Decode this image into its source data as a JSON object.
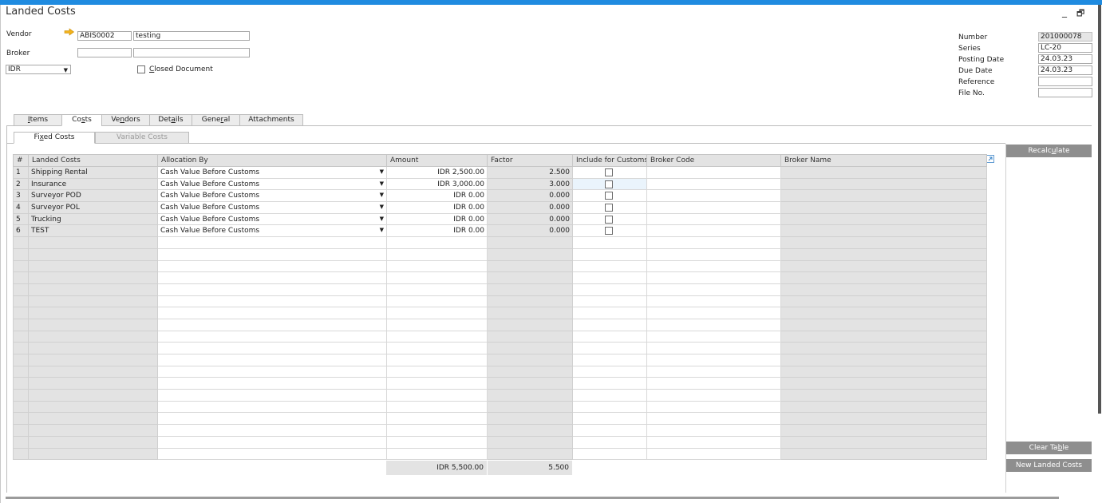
{
  "window": {
    "title": "Landed Costs",
    "minimize": "_",
    "restore": "🗗"
  },
  "header": {
    "vendor_label": "Vendor",
    "vendor_code": "ABIS0002",
    "vendor_name": "testing",
    "broker_label": "Broker",
    "broker_code": "",
    "broker_name": "",
    "currency": "IDR",
    "closed_label_pre": "",
    "closed_label_u": "C",
    "closed_label_post": "losed Document"
  },
  "doc": {
    "number_label": "Number",
    "number": "201000078",
    "series_label": "Series",
    "series": "LC-20",
    "posting_label": "Posting Date",
    "posting": "24.03.23",
    "due_label": "Due Date",
    "due": "24.03.23",
    "reference_label": "Reference",
    "reference": "",
    "file_label": "File No.",
    "file": ""
  },
  "tabs": [
    {
      "pre": "",
      "u": "I",
      "post": "tems"
    },
    {
      "pre": "Co",
      "u": "s",
      "post": "ts"
    },
    {
      "pre": "Ve",
      "u": "n",
      "post": "dors"
    },
    {
      "pre": "Det",
      "u": "a",
      "post": "ils"
    },
    {
      "pre": "Gene",
      "u": "r",
      "post": "al"
    },
    {
      "pre": "",
      "u": "",
      "post": "Attachments"
    }
  ],
  "subtabs": [
    {
      "pre": "Fi",
      "u": "x",
      "post": "ed Costs"
    },
    {
      "pre": "",
      "u": "",
      "post": "Variable Costs"
    }
  ],
  "grid": {
    "columns": [
      "#",
      "Landed Costs",
      "Allocation By",
      "Amount",
      "Factor",
      "Include for Customs",
      "Broker Code",
      "Broker Name"
    ],
    "rows": [
      {
        "n": "1",
        "name": "Shipping Rental",
        "alloc": "Cash Value Before Customs",
        "amount": "IDR 2,500.00",
        "factor": "2.500"
      },
      {
        "n": "2",
        "name": "Insurance",
        "alloc": "Cash Value Before Customs",
        "amount": "IDR 3,000.00",
        "factor": "3.000"
      },
      {
        "n": "3",
        "name": "Surveyor POD",
        "alloc": "Cash Value Before Customs",
        "amount": "IDR 0.00",
        "factor": "0.000"
      },
      {
        "n": "4",
        "name": "Surveyor POL",
        "alloc": "Cash Value Before Customs",
        "amount": "IDR 0.00",
        "factor": "0.000"
      },
      {
        "n": "5",
        "name": "Trucking",
        "alloc": "Cash Value Before Customs",
        "amount": "IDR 0.00",
        "factor": "0.000"
      },
      {
        "n": "6",
        "name": "TEST",
        "alloc": "Cash Value Before Customs",
        "amount": "IDR 0.00",
        "factor": "0.000"
      }
    ],
    "total_amount": "IDR 5,500.00",
    "total_factor": "5.500"
  },
  "buttons": {
    "recalc_pre": "Recalc",
    "recalc_u": "u",
    "recalc_post": "late",
    "clear_pre": "Clear Ta",
    "clear_u": "b",
    "clear_post": "le",
    "new_landed": "New Landed Costs"
  }
}
